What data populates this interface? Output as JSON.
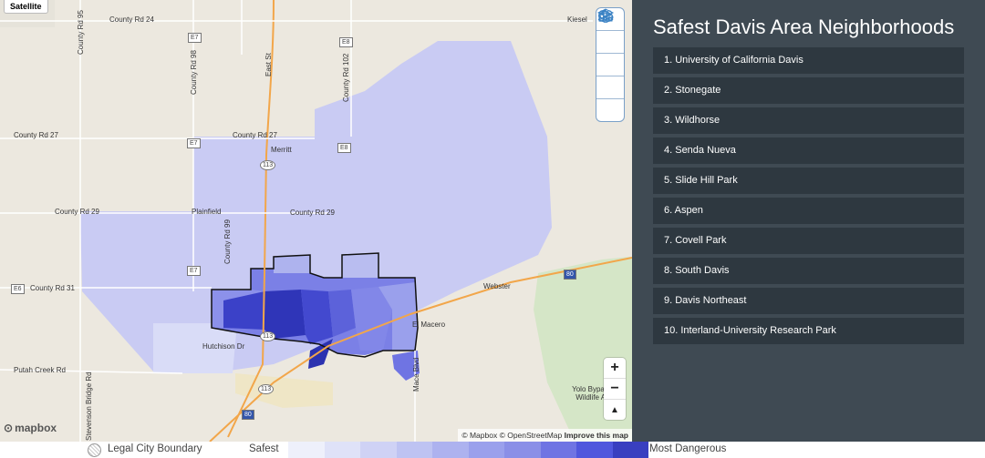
{
  "map": {
    "satellite_label": "Satellite",
    "attribution": {
      "mapbox": "© Mapbox",
      "osm": "© OpenStreetMap",
      "improve": "Improve this map"
    },
    "logo": "mapbox",
    "zoom": {
      "in": "+",
      "out": "−",
      "compass": "▲"
    },
    "tools": [
      "home-icon",
      "people-icon",
      "location-pins-icon",
      "schools-icon",
      "layers-icon"
    ],
    "labels": {
      "county_rd_24": "County Rd 24",
      "county_rd_27a": "County Rd 27",
      "county_rd_27b": "County Rd 27",
      "county_rd_29a": "County Rd 29",
      "county_rd_29b": "County Rd 29",
      "county_rd_31": "County Rd 31",
      "county_rd_95": "County Rd 95",
      "county_rd_98": "County Rd 98",
      "county_rd_99": "County Rd 99",
      "county_rd_102": "County Rd 102",
      "east_st": "East St",
      "kiesel": "Kiesel",
      "merritt": "Merritt",
      "plainfield": "Plainfield",
      "putah_creek": "Putah Creek Rd",
      "stevenson": "Stevenson Bridge Rd",
      "webster": "Webster",
      "hutchison": "Hutchison Dr",
      "el_macero": "El Macero",
      "mace_blvd": "Mace Blvd",
      "yolo_bypass": "Yolo Bypass Wildlife Ar",
      "e6": "E6",
      "e7a": "E7",
      "e7b": "E7",
      "e7c": "E7",
      "e8a": "E8",
      "e8b": "E8",
      "r113a": "113",
      "r113b": "113",
      "r113c": "113",
      "i80a": "80",
      "i80b": "80"
    }
  },
  "sidebar": {
    "title": "Safest Davis Area Neighborhoods",
    "items": [
      "1. University of California Davis",
      "2. Stonegate",
      "3. Wildhorse",
      "4. Senda Nueva",
      "5. Slide Hill Park",
      "6. Aspen",
      "7. Covell Park",
      "8. South Davis",
      "9. Davis Northeast",
      "10. Interland-University Research Park"
    ]
  },
  "legend": {
    "boundary_label": "Legal City Boundary",
    "safest_label": "Safest",
    "dangerous_label": "Most Dangerous",
    "colors": [
      "#eef0fb",
      "#dfe2f8",
      "#cfd2f5",
      "#bec3f2",
      "#adb2ef",
      "#9aa0ec",
      "#8a8fe7",
      "#6f74e3",
      "#5057dd",
      "#393fc0"
    ]
  }
}
